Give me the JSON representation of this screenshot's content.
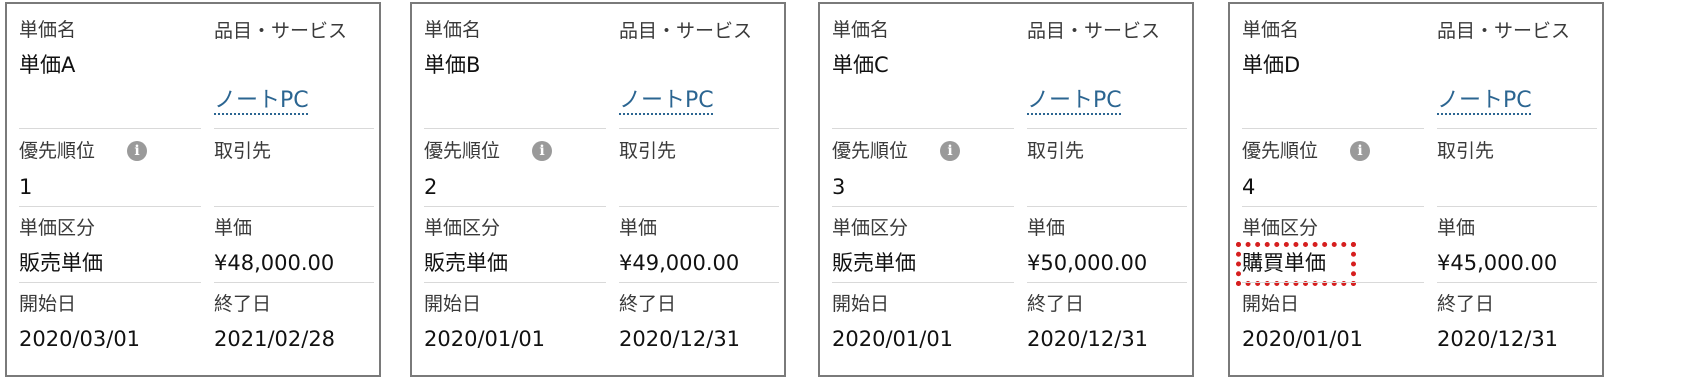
{
  "labels": {
    "name": "単価名",
    "product": "品目・サービス",
    "priority": "優先順位",
    "account": "取引先",
    "type": "単価区分",
    "price": "単価",
    "start": "開始日",
    "end": "終了日"
  },
  "cards": [
    {
      "name": "単価A",
      "product": "ノートPC",
      "priority": "1",
      "account": "",
      "type": "販売単価",
      "price": "¥48,000.00",
      "start": "2020/03/01",
      "end": "2021/02/28"
    },
    {
      "name": "単価B",
      "product": "ノートPC",
      "priority": "2",
      "account": "",
      "type": "販売単価",
      "price": "¥49,000.00",
      "start": "2020/01/01",
      "end": "2020/12/31"
    },
    {
      "name": "単価C",
      "product": "ノートPC",
      "priority": "3",
      "account": "",
      "type": "販売単価",
      "price": "¥50,000.00",
      "start": "2020/01/01",
      "end": "2020/12/31"
    },
    {
      "name": "単価D",
      "product": "ノートPC",
      "priority": "4",
      "account": "",
      "type": "購買単価",
      "price": "¥45,000.00",
      "start": "2020/01/01",
      "end": "2020/12/31"
    }
  ],
  "info_icon": {
    "glyph": "i",
    "icon": "info-icon"
  },
  "highlight_color": "#d61f1f"
}
